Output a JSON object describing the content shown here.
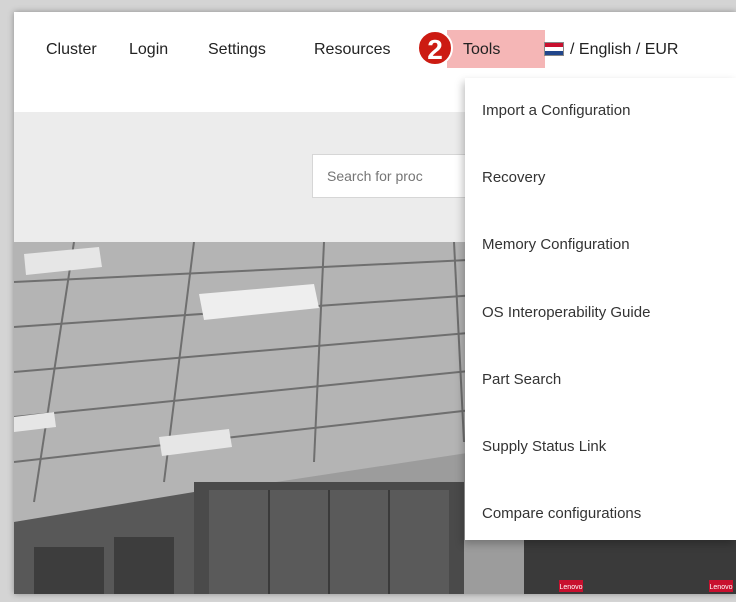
{
  "nav": {
    "items": [
      "Cluster",
      "Login",
      "Settings",
      "Resources",
      "Tools"
    ],
    "language_currency": "/ English / EUR",
    "step_badge": "2",
    "flag_icon": "netherlands-flag-icon",
    "highlight_color": "#f5b6b6",
    "badge_color": "#cc1b12"
  },
  "search": {
    "placeholder": "Search for proc"
  },
  "tools_menu": {
    "items": [
      "Import a Configuration",
      "Recovery",
      "Memory Configuration",
      "OS Interoperability Guide",
      "Part Search",
      "Supply Status Link",
      "Compare configurations"
    ]
  },
  "hero": {
    "rack_labels": [
      "Lenovo",
      "Lenovo"
    ]
  }
}
